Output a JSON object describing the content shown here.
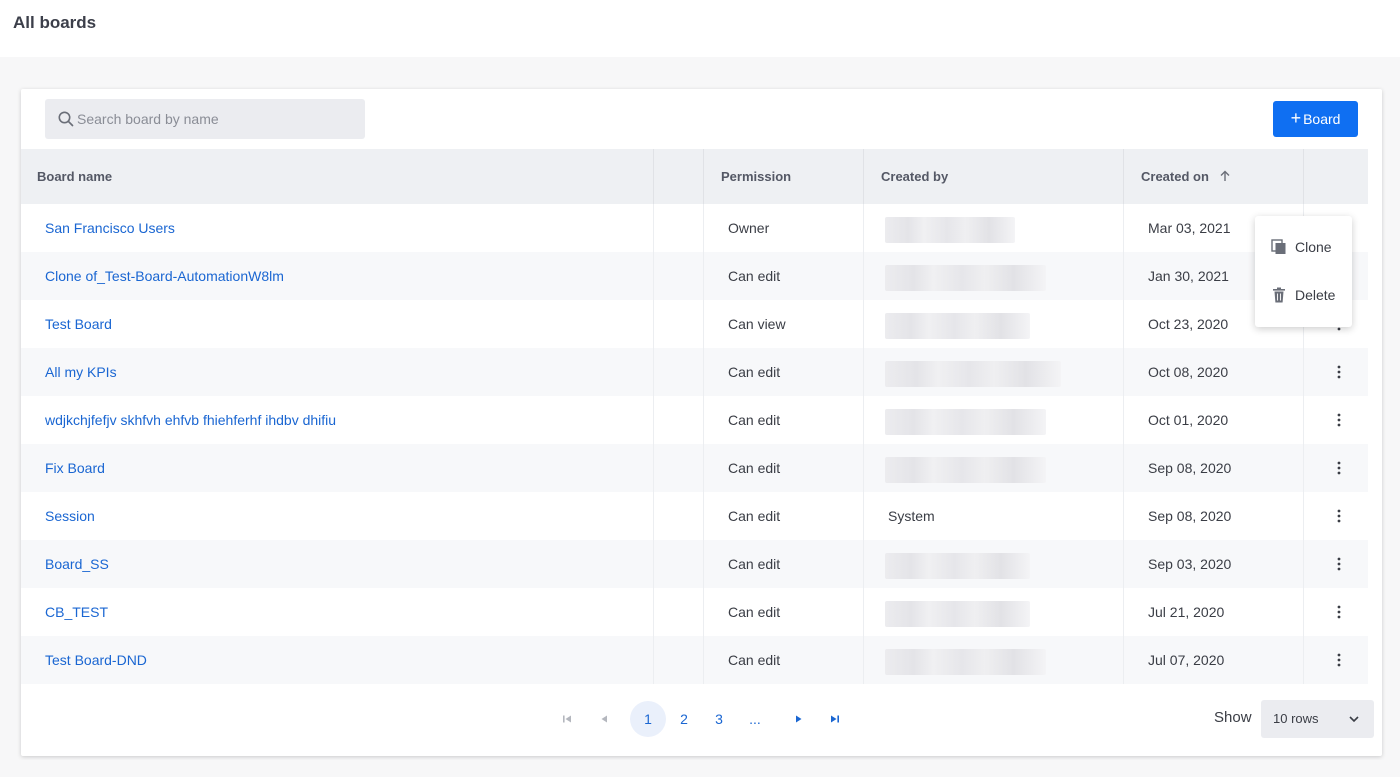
{
  "page": {
    "title": "All boards"
  },
  "toolbar": {
    "search_placeholder": "Search board by name",
    "search_value": "",
    "add_button_label": "Board",
    "add_button_icon": "plus-icon"
  },
  "table": {
    "columns": [
      "Board name",
      "",
      "Permission",
      "Created by",
      "Created on",
      ""
    ],
    "sort": {
      "column": "Created on",
      "direction": "ascending",
      "icon": "arrow-up-icon"
    },
    "rows": [
      {
        "name": "San Francisco Users",
        "permission": "Owner",
        "created_by": "",
        "created_on": "Mar 03, 2021"
      },
      {
        "name": "Clone of_Test-Board-AutomationW8lm",
        "permission": "Can edit",
        "created_by": "",
        "created_on": "Jan 30, 2021"
      },
      {
        "name": "Test Board",
        "permission": "Can view",
        "created_by": "",
        "created_on": "Oct 23, 2020"
      },
      {
        "name": "All my KPIs",
        "permission": "Can edit",
        "created_by": "",
        "created_on": "Oct 08, 2020"
      },
      {
        "name": "wdjkchjfefjv skhfvh ehfvb fhiehferhf ihdbv dhifiu",
        "permission": "Can edit",
        "created_by": "",
        "created_on": "Oct 01, 2020"
      },
      {
        "name": "Fix Board",
        "permission": "Can edit",
        "created_by": "",
        "created_on": "Sep 08, 2020"
      },
      {
        "name": "Session",
        "permission": "Can edit",
        "created_by": "System",
        "created_on": "Sep 08, 2020"
      },
      {
        "name": "Board_SS",
        "permission": "Can edit",
        "created_by": "",
        "created_on": "Sep 03, 2020"
      },
      {
        "name": "CB_TEST",
        "permission": "Can edit",
        "created_by": "",
        "created_on": "Jul 21, 2020"
      },
      {
        "name": "Test Board-DND",
        "permission": "Can edit",
        "created_by": "",
        "created_on": "Jul 07, 2020"
      }
    ]
  },
  "context_menu": {
    "items": [
      {
        "label": "Clone",
        "icon": "clone-icon"
      },
      {
        "label": "Delete",
        "icon": "trash-icon"
      }
    ]
  },
  "pagination": {
    "pages": [
      "1",
      "2",
      "3",
      "..."
    ],
    "current_page": "1",
    "show_label": "Show",
    "rows_per_page": "10 rows"
  },
  "colors": {
    "primary": "#0f6ff2",
    "link": "#1a66d2",
    "header_bg": "#eef0f3"
  }
}
